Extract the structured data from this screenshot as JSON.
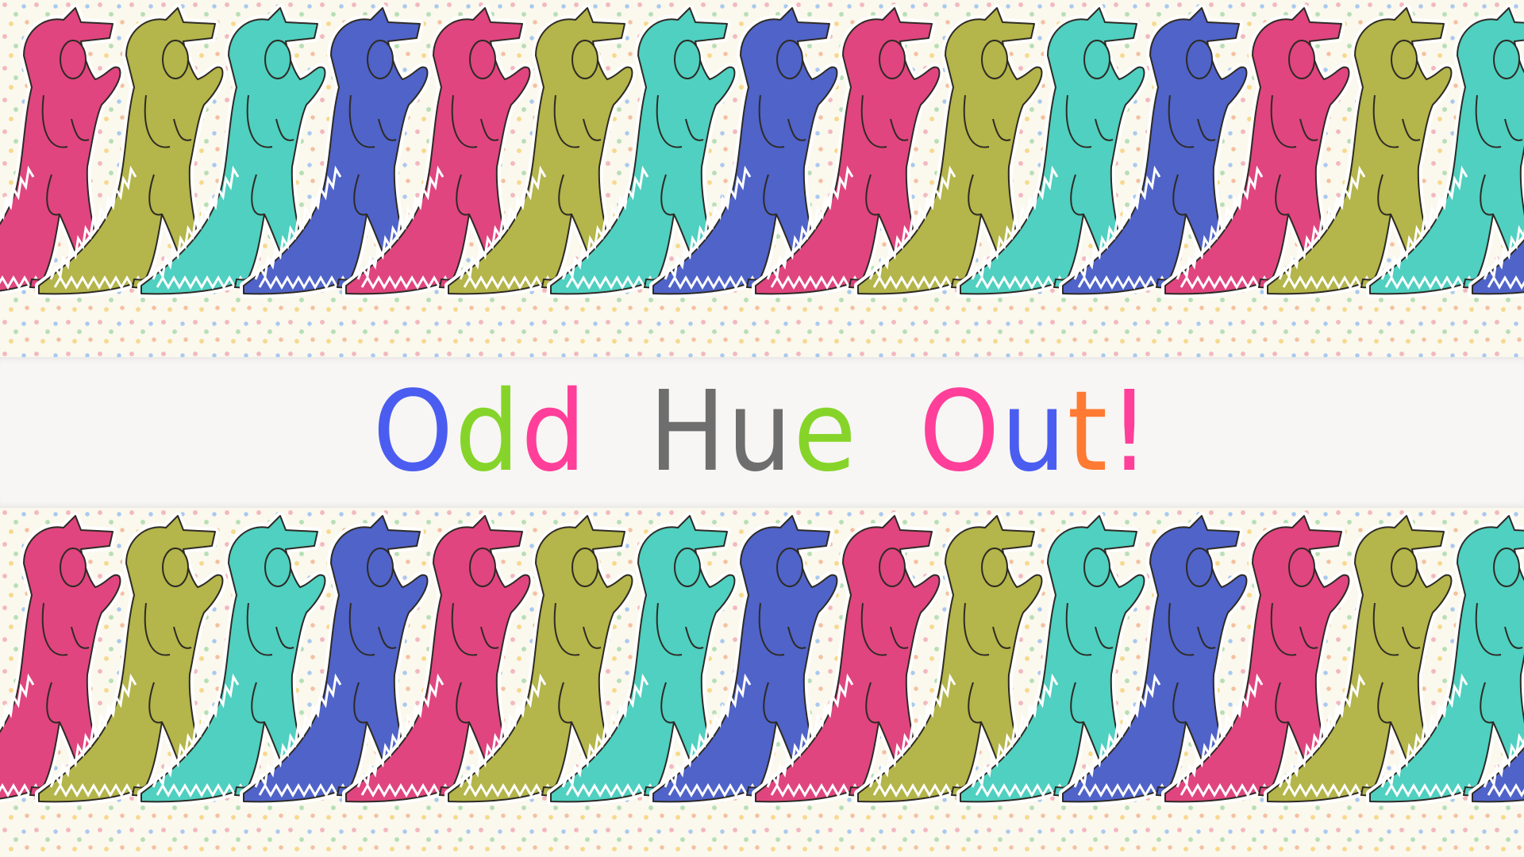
{
  "title": {
    "words": [
      {
        "letters": [
          {
            "char": "O",
            "color": "#4a5df0"
          },
          {
            "char": "d",
            "color": "#86d42a"
          },
          {
            "char": "d",
            "color": "#ff3f9a"
          }
        ]
      },
      {
        "letters": [
          {
            "char": "H",
            "color": "#6e6e6e"
          },
          {
            "char": "u",
            "color": "#6e6e6e"
          },
          {
            "char": "e",
            "color": "#86d42a"
          }
        ]
      },
      {
        "letters": [
          {
            "char": "O",
            "color": "#ff3f9a"
          },
          {
            "char": "u",
            "color": "#4a5df0"
          },
          {
            "char": "t",
            "color": "#ff7a33"
          },
          {
            "char": "!",
            "color": "#ff3f9a"
          }
        ]
      }
    ]
  },
  "pattern": {
    "dino_colors": [
      "#e0457f",
      "#b4b54a",
      "#4fd0c0",
      "#4f63c9"
    ],
    "outline_color": "#2e2a24",
    "background_dots": [
      "#f2b8c0",
      "#b7dfb5",
      "#f7d98d",
      "#a9c9ef",
      "#f4c0a0"
    ]
  }
}
